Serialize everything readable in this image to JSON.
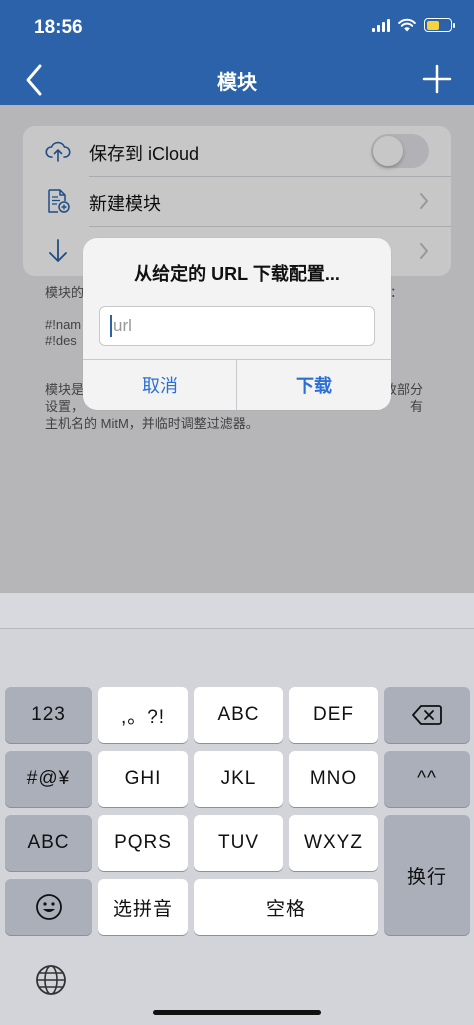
{
  "status": {
    "time": "18:56"
  },
  "nav": {
    "title": "模块"
  },
  "settings": {
    "icloud_label": "保存到 iCloud",
    "new_module_label": "新建模块"
  },
  "description": {
    "line1": "模块的",
    "line1_end": "：",
    "line2": "#!nam",
    "line3": "#!des",
    "para_start": "模块是",
    "para_end": "改部分",
    "line_b": "设置，",
    "line_b_end": "有",
    "line_c": "主机名的 MitM，并临时调整过滤器。"
  },
  "alert": {
    "title": "从给定的 URL 下载配置...",
    "input_placeholder": "url",
    "cancel_label": "取消",
    "download_label": "下载"
  },
  "keyboard": {
    "row1": [
      "123",
      ",。?!",
      "ABC",
      "DEF"
    ],
    "row2": [
      "#@¥",
      "GHI",
      "JKL",
      "MNO",
      "^^"
    ],
    "row3": [
      "ABC",
      "PQRS",
      "TUV",
      "WXYZ"
    ],
    "return_label": "换行",
    "pinyin_label": "选拼音",
    "space_label": "空格"
  },
  "colors": {
    "nav_bar": "#2b62a9",
    "alert_button": "#2b6fd6",
    "battery": "#f6d23c"
  }
}
